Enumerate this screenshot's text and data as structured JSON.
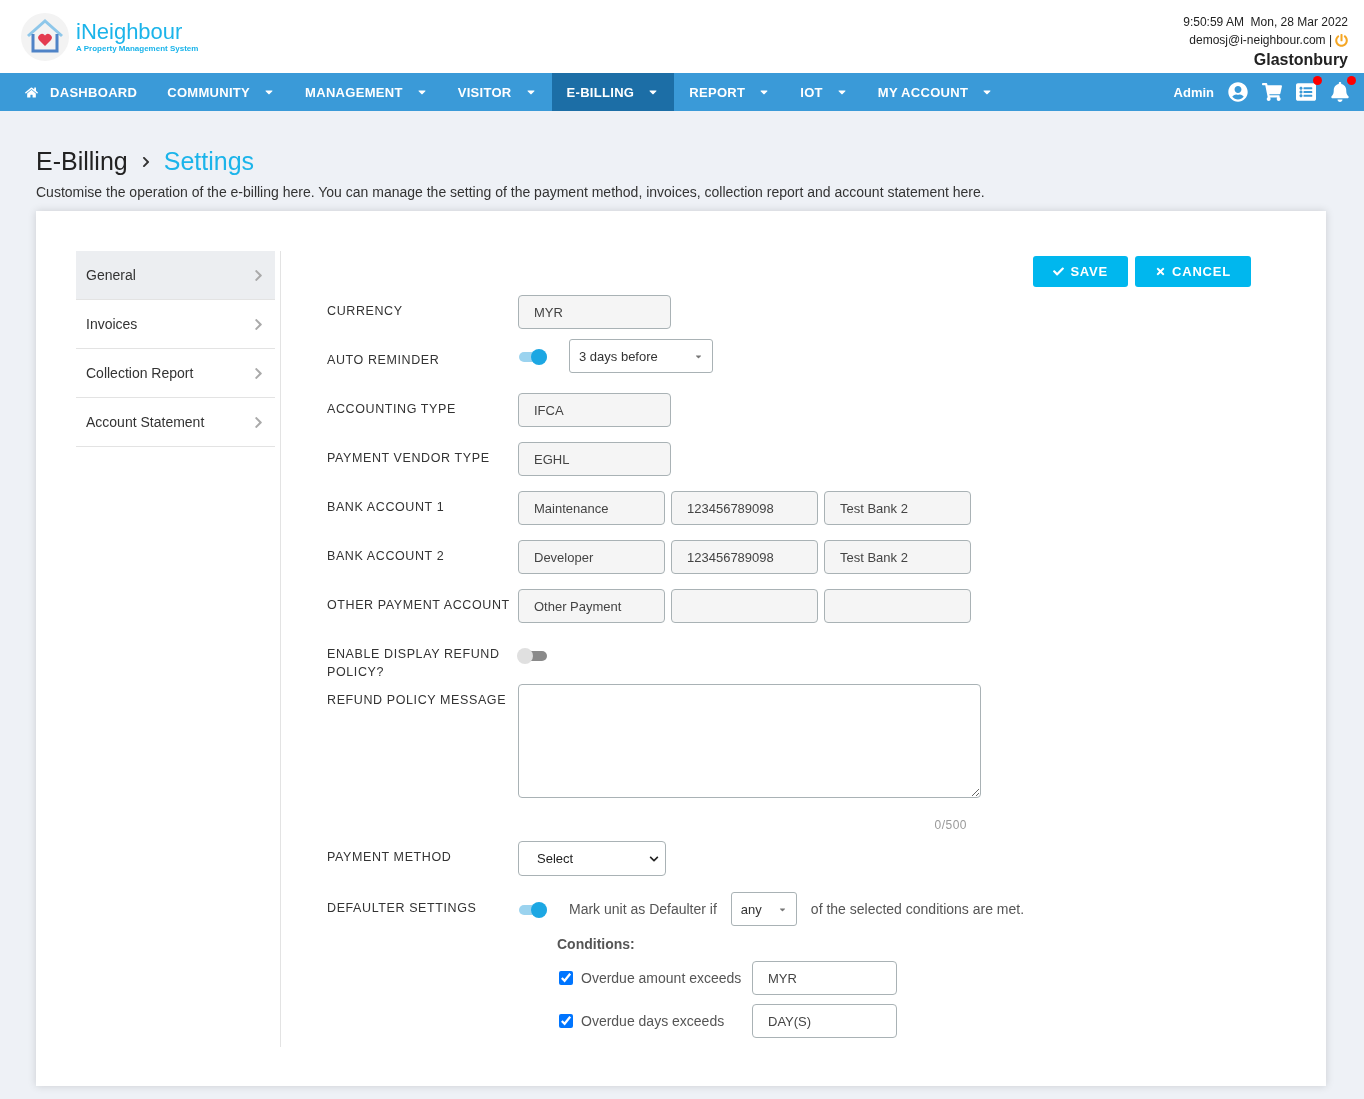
{
  "header": {
    "logo": {
      "name": "iNeighbour",
      "tagline": "A Property Management System"
    },
    "datetime": "9:50:59 AM  Mon, 28 Mar 2022",
    "email": "demosj@i-neighbour.com |",
    "site": "Glastonbury"
  },
  "nav": {
    "items": [
      {
        "kind": "home",
        "label": "DASHBOARD",
        "selected": false
      },
      {
        "kind": "menu",
        "label": "COMMUNITY",
        "selected": false
      },
      {
        "kind": "menu",
        "label": "MANAGEMENT",
        "selected": false
      },
      {
        "kind": "menu",
        "label": "VISITOR",
        "selected": false
      },
      {
        "kind": "menu",
        "label": "E-BILLING",
        "selected": true
      },
      {
        "kind": "menu",
        "label": "REPORT",
        "selected": false
      },
      {
        "kind": "menu",
        "label": "IOT",
        "selected": false
      },
      {
        "kind": "menu",
        "label": "MY ACCOUNT",
        "selected": false
      }
    ],
    "user": "Admin",
    "tools": [
      {
        "kind": "profile",
        "badge": false
      },
      {
        "kind": "cart",
        "badge": false
      },
      {
        "kind": "list",
        "badge": true
      },
      {
        "kind": "bell",
        "badge": true
      }
    ]
  },
  "page": {
    "section": "E-Billing",
    "current": "Settings",
    "description": "Customise the operation of the e-billing here. You can manage the setting of the payment method, invoices, collection report and account statement here."
  },
  "sidebar": {
    "items": [
      {
        "label": "General",
        "selected": true
      },
      {
        "label": "Invoices",
        "selected": false
      },
      {
        "label": "Collection Report",
        "selected": false
      },
      {
        "label": "Account Statement",
        "selected": false
      }
    ]
  },
  "actions": {
    "save": "SAVE",
    "cancel": "CANCEL"
  },
  "form": [
    {
      "kind": "text",
      "label": "CURRENCY",
      "fields": [
        {
          "value": "MYR"
        }
      ]
    },
    {
      "kind": "toggle_select",
      "label": "AUTO REMINDER",
      "on": true,
      "value": "3 days before"
    },
    {
      "kind": "text",
      "label": "ACCOUNTING TYPE",
      "fields": [
        {
          "value": "IFCA"
        }
      ]
    },
    {
      "kind": "text",
      "label": "PAYMENT VENDOR TYPE",
      "fields": [
        {
          "value": "EGHL"
        }
      ]
    },
    {
      "kind": "triple",
      "label": "BANK ACCOUNT 1",
      "fields": [
        {
          "value": "Maintenance"
        },
        {
          "value": "123456789098"
        },
        {
          "value": "Test Bank 2"
        }
      ]
    },
    {
      "kind": "triple",
      "label": "BANK ACCOUNT 2",
      "fields": [
        {
          "value": "Developer"
        },
        {
          "value": "123456789098"
        },
        {
          "value": "Test Bank 2"
        }
      ]
    },
    {
      "kind": "triple",
      "label": "OTHER PAYMENT ACCOUNT",
      "fields": [
        {
          "value": "Other Payment"
        }
      ]
    },
    {
      "kind": "toggle",
      "label": "ENABLE DISPLAY REFUND POLICY?",
      "on": false
    },
    {
      "kind": "textarea",
      "label": "REFUND POLICY MESSAGE",
      "counter": "0/500"
    },
    {
      "kind": "select",
      "label": "PAYMENT METHOD",
      "value": "Select"
    },
    {
      "kind": "defaulter",
      "label": "DEFAULTER SETTINGS",
      "on": true,
      "prefix": "Mark unit as Defaulter if",
      "value": "any",
      "suffix": "of the selected conditions are met.",
      "conditions_title": "Conditions:",
      "conditions": [
        {
          "label": "Overdue amount exceeds",
          "checked": true,
          "unit": "MYR"
        },
        {
          "label": "Overdue days exceeds",
          "checked": true,
          "unit": "DAY(S)"
        }
      ]
    }
  ]
}
